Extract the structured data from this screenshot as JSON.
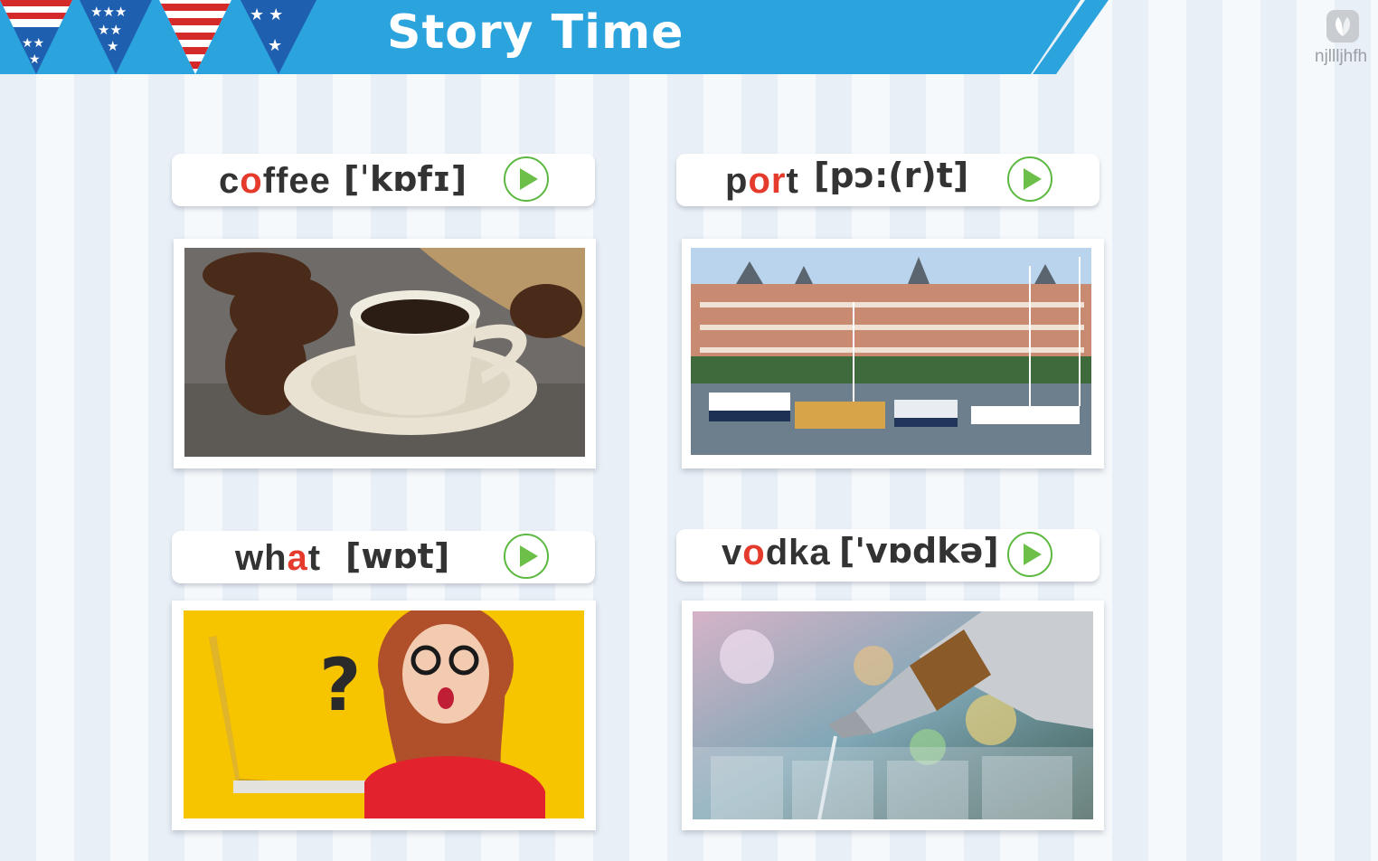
{
  "header": {
    "title": "Story Time"
  },
  "watermark": {
    "text": "njllljhfh",
    "icon": "leaf-logo-icon"
  },
  "colors": {
    "banner": "#2ba3dd",
    "highlight": "#e53b2c",
    "play": "#6cc04a"
  },
  "words": [
    {
      "pre": "c",
      "hl": "o",
      "post": "ffee",
      "ipa": "[ˈkɒfɪ]",
      "image": "coffee-cup-photo"
    },
    {
      "pre": "p",
      "hl": "or",
      "post": "t",
      "ipa": "[pɔ:(r)t]",
      "image": "harbor-photo"
    },
    {
      "pre": "wh",
      "hl": "a",
      "post": "t",
      "ipa": "[wɒt]",
      "image": "woman-laptop-photo"
    },
    {
      "pre": "v",
      "hl": "o",
      "post": "dka",
      "ipa": "['vɒdkə]",
      "image": "vodka-pour-photo"
    }
  ]
}
